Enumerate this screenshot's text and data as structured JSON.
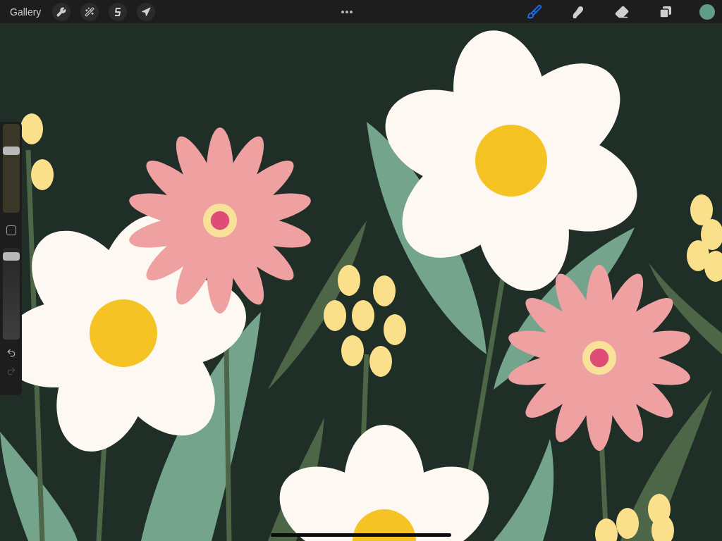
{
  "toolbar": {
    "gallery": "Gallery",
    "left_tools": [
      {
        "kind": "wrench",
        "selected": false
      },
      {
        "kind": "wand",
        "selected": false
      },
      {
        "kind": "selection",
        "selected": false
      },
      {
        "kind": "transform",
        "selected": false
      }
    ],
    "right_tools": [
      {
        "kind": "brush",
        "selected": true
      },
      {
        "kind": "smudge",
        "selected": false
      },
      {
        "kind": "eraser",
        "selected": false
      },
      {
        "kind": "layers",
        "selected": false
      }
    ],
    "color_swatch": {
      "color": "#5f9c8a"
    }
  },
  "sidebar": {
    "brush_size": {
      "level": 0.7
    },
    "opacity": {
      "level": 0.91
    },
    "undo": {
      "disabled": false
    },
    "redo": {
      "disabled": true
    }
  }
}
